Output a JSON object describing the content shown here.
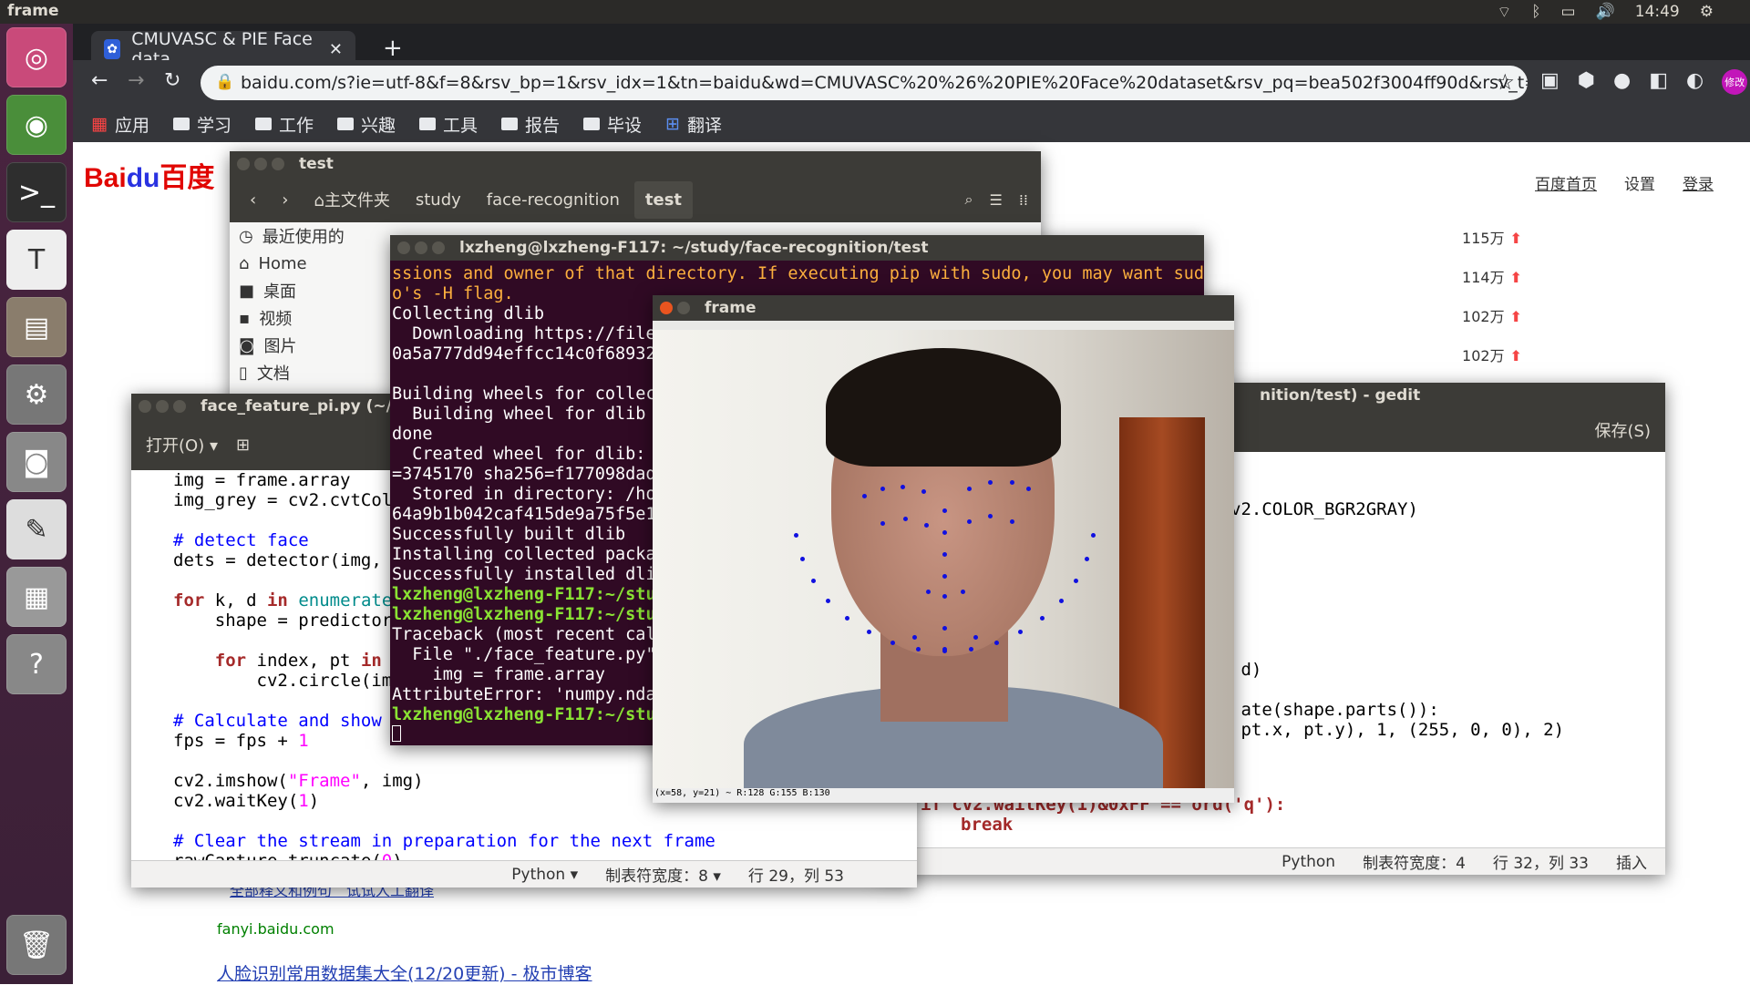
{
  "topbar": {
    "title": "frame",
    "time": "14:49"
  },
  "browser": {
    "tab_title": "CMUVASC & PIE Face data",
    "url": "baidu.com/s?ie=utf-8&f=8&rsv_bp=1&rsv_idx=1&tn=baidu&wd=CMUVASC%20%26%20PIE%20Face%20dataset&rsv_pq=bea502f3004ff90d&rsv_t=0b4b...",
    "avatar_text": "修改",
    "bookmarks": [
      "应用",
      "学习",
      "工作",
      "兴趣",
      "工具",
      "报告",
      "毕设",
      "翻译"
    ]
  },
  "baidu": {
    "logo_a": "Bai",
    "logo_b": "du",
    "logo_c": "百度",
    "nav": [
      "百度首页",
      "设置",
      "登录"
    ],
    "hot": [
      "115万",
      "114万",
      "102万",
      "102万"
    ],
    "fanyi_links": "全部释义和例句　试试人工翻译",
    "fanyi_site": "fanyi.baidu.com",
    "result_title": "人脸识别常用数据集大全(12/20更新) - 极市博客"
  },
  "nautilus": {
    "title": "test",
    "crumbs": [
      "主文件夹",
      "study",
      "face-recognition",
      "test"
    ],
    "sidebar": [
      "最近使用的",
      "Home",
      "桌面",
      "视频",
      "图片",
      "文档"
    ]
  },
  "terminal": {
    "title": "lxzheng@lxzheng-F117: ~/study/face-recognition/test",
    "warn1": "ssions and owner of that directory. If executing pip with sudo, you may want sud",
    "warn2": "o's -H flag.",
    "lines": [
      "Collecting dlib",
      "  Downloading https://file",
      "0a5a777dd94effcc14c0f68932",
      "",
      "Building wheels for collec",
      "  Building wheel for dlib ",
      "done",
      "  Created wheel for dlib: ",
      "=3745170 sha256=f177098dad",
      "  Stored in directory: /ho",
      "64a9b1b042caf415de9a75f5e1",
      "Successfully built dlib",
      "Installing collected packa",
      "Successfully installed dli"
    ],
    "prompt1": "lxzheng@lxzheng-F117:~/stu",
    "prompt2": "lxzheng@lxzheng-F117:~/stu",
    "trace": [
      "Traceback (most recent cal",
      "  File \"./face_feature.py\"",
      "    img = frame.array",
      "AttributeError: 'numpy.nda"
    ],
    "prompt3": "lxzheng@lxzheng-F117:~/stu"
  },
  "gedit_left": {
    "title": "face_feature_pi.py (~/stu",
    "open": "打开(O)",
    "status_lang": "Python",
    "status_tab": "制表符宽度：8",
    "status_pos": "行 29，列 53"
  },
  "gedit_right": {
    "title": "nition/test) - gedit",
    "save": "保存(S)",
    "code1": "v2.COLOR_BGR2GRAY)",
    "code2": "d)",
    "code3a": "ate(shape.parts()):",
    "code3b": "pt.x, pt.y), 1, (255, 0, 0), 2)",
    "code4": "if cv2.waitKey(1)&0xFF == ord('q'):",
    "code5": "break",
    "status_lang": "Python",
    "status_tab": "制表符宽度：4",
    "status_pos": "行 32，列 33",
    "status_mode": "插入"
  },
  "frame": {
    "title": "frame",
    "status": "(x=58, y=21) ~ R:128 G:155 B:130"
  }
}
